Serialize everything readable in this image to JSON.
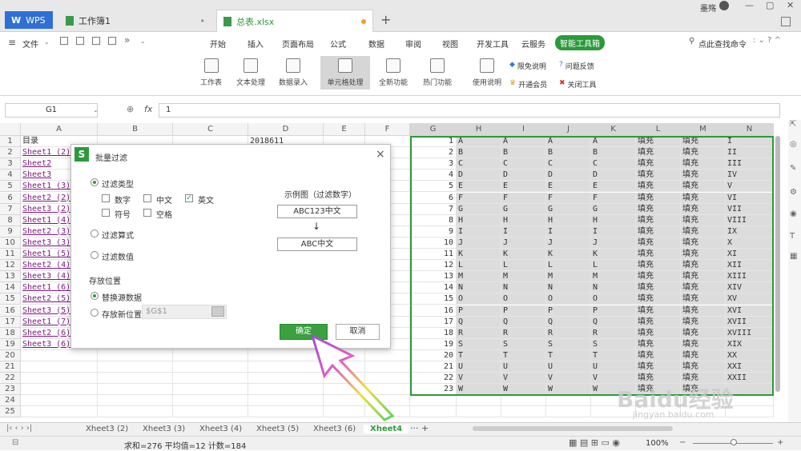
{
  "titlebar": {
    "app_tab": "WPS",
    "doc_tab": "工作簿1",
    "active_tab": "总表.xlsx",
    "user": "墨殇"
  },
  "menubar": {
    "file_label": "文件",
    "menus": [
      "开始",
      "插入",
      "页面布局",
      "公式",
      "数据",
      "审阅",
      "视图",
      "开发工具",
      "云服务",
      "智能工具箱"
    ],
    "search_label": "点此查找命令"
  },
  "ribbon": {
    "buttons": [
      "工作表",
      "文本处理",
      "数据录入",
      "单元格处理",
      "全新功能",
      "热门功能",
      "使用说明"
    ],
    "side_items": [
      "限免说明",
      "问题反馈",
      "开通会员",
      "关闭工具"
    ]
  },
  "formulabar": {
    "name_box": "G1",
    "fx": "fx",
    "value": "1"
  },
  "columns": {
    "left": [
      "A",
      "B",
      "C",
      "D",
      "E",
      "F"
    ],
    "right": [
      "G",
      "H",
      "I",
      "J",
      "K",
      "L",
      "M",
      "N"
    ]
  },
  "rows": [
    "1",
    "2",
    "3",
    "4",
    "5",
    "6",
    "7",
    "8",
    "9",
    "10",
    "11",
    "12",
    "13",
    "14",
    "15",
    "16",
    "17",
    "18",
    "19",
    "20",
    "21",
    "22",
    "23",
    "24",
    "25"
  ],
  "col_a": [
    "目录",
    "Sheet1 (2)",
    "Sheet2",
    "Sheet3",
    "Sheet1 (3)",
    "Sheet2 (2)",
    "Sheet3 (2)",
    "Sheet1 (4)",
    "Sheet2 (3)",
    "Sheet3 (3)",
    "Sheet1 (5)",
    "Sheet2 (4)",
    "Sheet3 (4)",
    "Sheet1 (6)",
    "Sheet2 (5)",
    "Sheet3 (5)",
    "Sheet1 (7)",
    "Sheet2 (6)",
    "Sheet3 (6)"
  ],
  "d1": "2018611",
  "letters": [
    "A",
    "B",
    "C",
    "D",
    "E",
    "F",
    "G",
    "H",
    "I",
    "J",
    "K",
    "L",
    "M",
    "N",
    "O",
    "P",
    "Q",
    "R",
    "S",
    "T",
    "U",
    "V",
    "W"
  ],
  "fill_text": "填充",
  "roman": [
    "I",
    "II",
    "III",
    "IV",
    "V",
    "VI",
    "VII",
    "VIII",
    "IX",
    "X",
    "XI",
    "XII",
    "XIII",
    "XIV",
    "XV",
    "XVI",
    "XVII",
    "XVIII",
    "XIX",
    "XX",
    "XXI",
    "XXII",
    ""
  ],
  "dialog": {
    "title": "批量过滤",
    "filter_type": "过滤类型",
    "opt_number": "数字",
    "opt_chinese": "中文",
    "opt_english": "英文",
    "opt_symbol": "符号",
    "opt_space": "空格",
    "filter_formula": "过滤算式",
    "filter_value": "过滤数值",
    "store_location": "存放位置",
    "replace_source": "替换源数据",
    "store_new": "存放新位置",
    "new_location_value": "$G$1",
    "example_title": "示例图（过滤数字）",
    "example_before": "ABC123中文",
    "example_after": "ABC中文",
    "ok": "确定",
    "cancel": "取消",
    "close": "×"
  },
  "sheettabs": [
    "Xheet3 (2)",
    "Xheet3 (3)",
    "Xheet3 (4)",
    "Xheet3 (5)",
    "Xheet3 (6)",
    "Xheet4"
  ],
  "statusbar": {
    "summary": "求和=276  平均值=12  计数=184",
    "zoom": "100%"
  },
  "watermark": "Baidu经验",
  "watermark_url": "jingyan.baidu.com",
  "colors": {
    "accent": "#2b9a3a",
    "brand": "#1d8f3c"
  }
}
